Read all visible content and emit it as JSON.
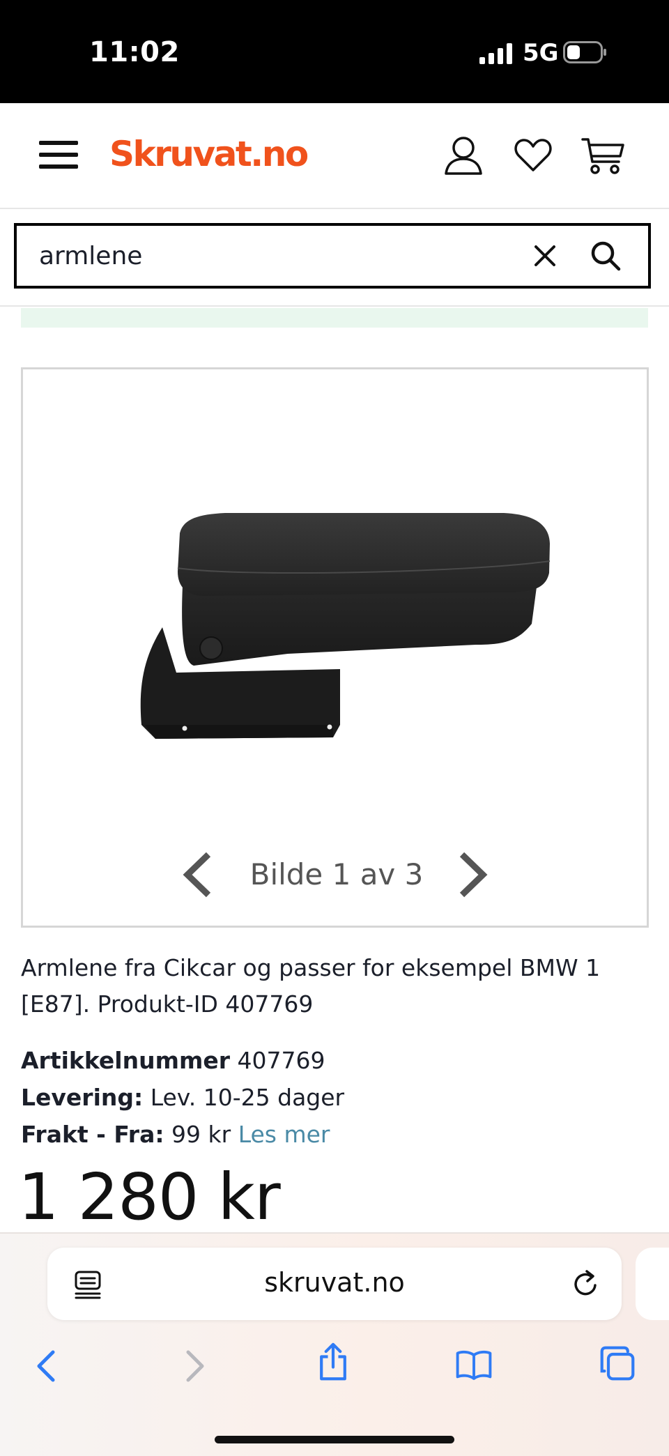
{
  "status_bar": {
    "time": "11:02",
    "network": "5G"
  },
  "header": {
    "logo": "Skruvat.no"
  },
  "search": {
    "value": "armlene"
  },
  "gallery": {
    "counter": "Bilde 1 av 3",
    "image_alt": "Armlene fra Cikcar"
  },
  "product": {
    "description": "Armlene fra Cikcar og passer for eksempel BMW 1 [E87]. Produkt-ID 407769",
    "article_label": "Artikkelnummer",
    "article_value": " 407769",
    "delivery_label": "Levering:",
    "delivery_value": " Lev. 10-25 dager",
    "shipping_label": "Frakt - Fra:",
    "shipping_value": " 99 kr ",
    "shipping_link": "Les mer",
    "price": "1 280 kr"
  },
  "browser": {
    "url": "skruvat.no"
  },
  "colors": {
    "brand": "#f0521c",
    "link": "#4a8aa6",
    "note_bar": "#e9f7ee"
  }
}
